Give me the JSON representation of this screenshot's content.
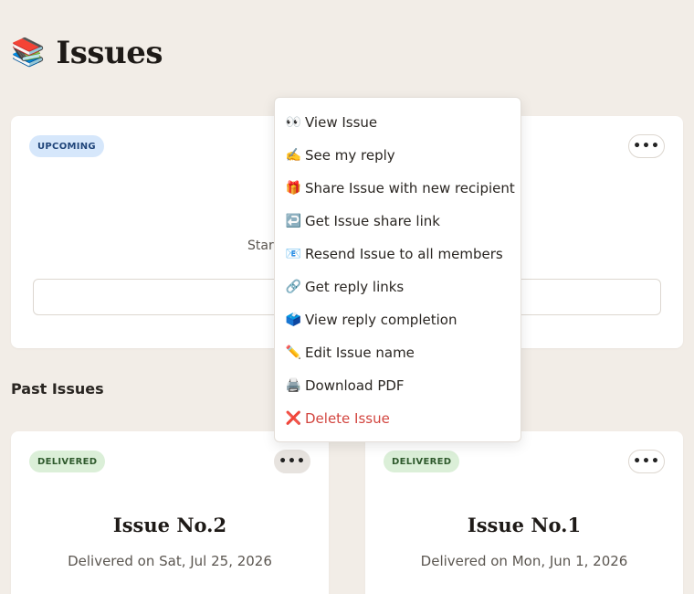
{
  "header": {
    "emoji": "📚",
    "title": "Issues"
  },
  "upcoming_card": {
    "badge": "UPCOMING",
    "more_label": "•••",
    "subtitle": "Star"
  },
  "past_section": {
    "title": "Past Issues"
  },
  "past_issues": [
    {
      "badge": "DELIVERED",
      "more_label": "•••",
      "title": "Issue No.2",
      "date": "Delivered on Sat, Jul 25, 2026"
    },
    {
      "badge": "DELIVERED",
      "more_label": "•••",
      "title": "Issue No.1",
      "date": "Delivered on Mon, Jun 1, 2026"
    }
  ],
  "menu": {
    "items": [
      {
        "icon": "👀",
        "label": "View Issue"
      },
      {
        "icon": "✍️",
        "label": "See my reply"
      },
      {
        "icon": "🎁",
        "label": "Share Issue with new recipient"
      },
      {
        "icon": "↩️",
        "label": "Get Issue share link"
      },
      {
        "icon": "📧",
        "label": "Resend Issue to all members"
      },
      {
        "icon": "🔗",
        "label": "Get reply links"
      },
      {
        "icon": "🗳️",
        "label": "View reply completion"
      },
      {
        "icon": "✏️",
        "label": "Edit Issue name"
      },
      {
        "icon": "🖨️",
        "label": "Download PDF"
      },
      {
        "icon": "❌",
        "label": "Delete Issue"
      }
    ]
  },
  "colors": {
    "background": "#f2ede7",
    "upcoming_badge": "#d6e7fb",
    "delivered_badge": "#dbefd8",
    "danger": "#d2453f"
  }
}
